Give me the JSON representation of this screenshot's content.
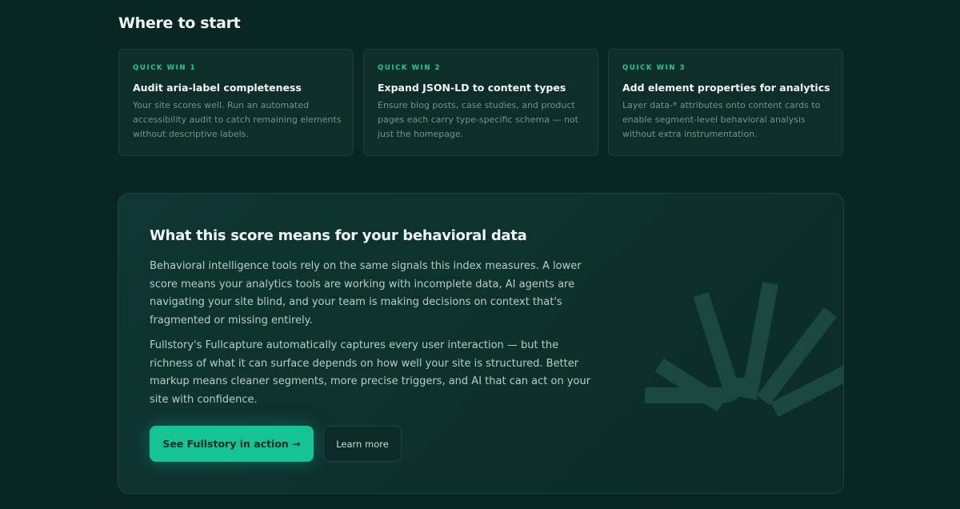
{
  "section": {
    "title": "Where to start"
  },
  "quick_wins": [
    {
      "tag": "QUICK WIN 1",
      "title": "Audit aria-label completeness",
      "body": "Your site scores well. Run an automated accessibility audit to catch remaining elements without descriptive labels."
    },
    {
      "tag": "QUICK WIN 2",
      "title": "Expand JSON-LD to content types",
      "body": "Ensure blog posts, case studies, and product pages each carry type-specific schema — not just the homepage."
    },
    {
      "tag": "QUICK WIN 3",
      "title": "Add element properties for analytics",
      "body": "Layer data-* attributes onto content cards to enable segment-level behavioral analysis without extra instrumentation."
    }
  ],
  "panel": {
    "title": "What this score means for your behavioral data",
    "paragraph_1": "Behavioral intelligence tools rely on the same signals this index measures. A lower score means your analytics tools are working with incomplete data, AI agents are navigating your site blind, and your team is making decisions on context that's fragmented or missing entirely.",
    "paragraph_2": "Fullstory's Fullcapture automatically captures every user interaction — but the richness of what it can surface depends on how well your site is structured. Better markup means cleaner segments, more precise triggers, and AI that can act on your site with confidence.",
    "primary_button": "See Fullstory in action →",
    "secondary_button": "Learn more"
  },
  "colors": {
    "background": "#0a2623",
    "accent": "#15c394",
    "tag": "#22c898",
    "card": "#0e2e2a"
  },
  "icons": {
    "decoration": "fullstory-burst-logo"
  }
}
